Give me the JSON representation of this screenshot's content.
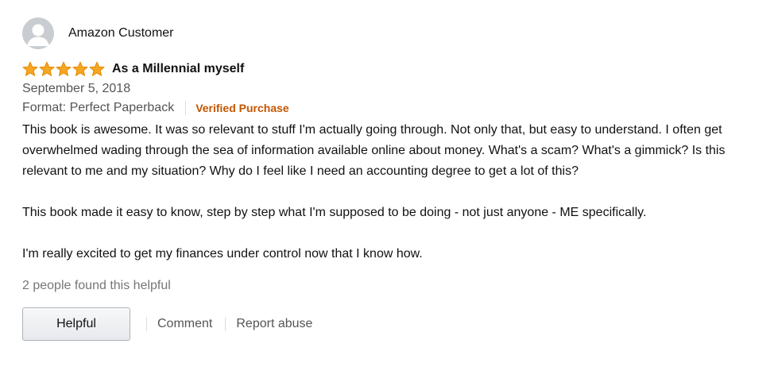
{
  "reviewer": {
    "name": "Amazon Customer",
    "avatar_icon": "default-profile-avatar"
  },
  "rating": {
    "value": 5,
    "max": 5,
    "star_color": "#f5a623",
    "star_outline": "#e68a00"
  },
  "review": {
    "title": "As a Millennial myself",
    "date": "September 5, 2018",
    "format": "Format: Perfect Paperback",
    "verified": "Verified Purchase",
    "verified_color": "#c45500",
    "paragraphs": [
      "This book is awesome. It was so relevant to stuff I'm actually going through. Not only that, but easy to understand. I often get overwhelmed wading through the sea of information available online about money. What's a scam? What's a gimmick? Is this relevant to me and my situation? Why do I feel like I need an accounting degree to get a lot of this?",
      "This book made it easy to know, step by step what I'm supposed to be doing - not just anyone - ME specifically.",
      "I'm really excited to get my finances under control now that I know how."
    ],
    "helpful_count_text": "2 people found this helpful"
  },
  "actions": {
    "helpful_label": "Helpful",
    "comment_label": "Comment",
    "report_label": "Report abuse"
  }
}
